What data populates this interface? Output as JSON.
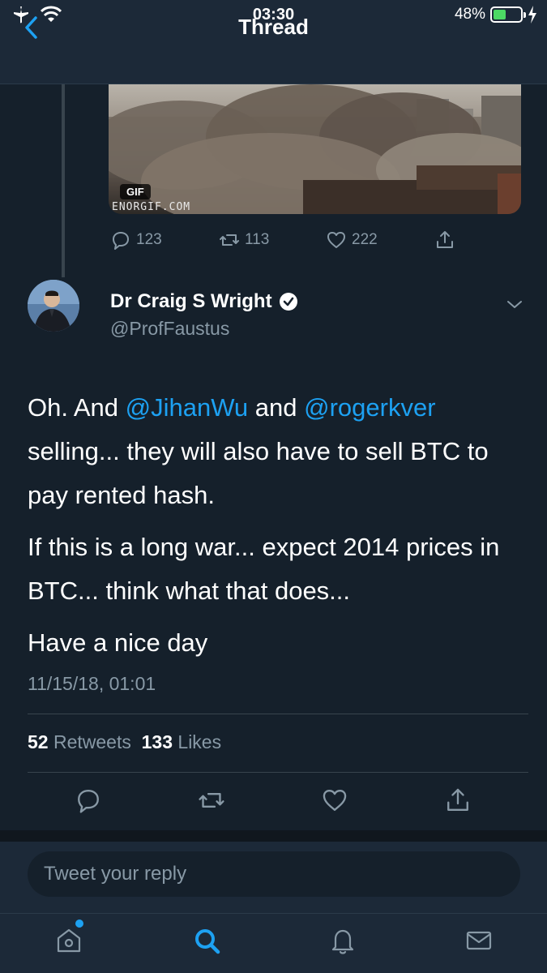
{
  "status": {
    "time": "03:30",
    "battery": "48%",
    "battery_level": 0.48
  },
  "nav": {
    "title": "Thread"
  },
  "prev_tweet": {
    "gif_badge": "GIF",
    "gif_watermark": "ENORGIF.COM",
    "replies": "123",
    "retweets": "113",
    "likes": "222"
  },
  "tweet": {
    "author": "Dr Craig S Wright",
    "handle": "@ProfFaustus",
    "para1_a": "Oh. And ",
    "mention1": "@JihanWu",
    "para1_b": " and ",
    "mention2": "@rogerkver",
    "para1_c": " selling... they will also have to sell BTC to pay rented hash.",
    "para2": "If this is a long war... expect 2014 prices in BTC... think what that does...",
    "para3": "Have a nice day",
    "date": "11/15/18, 01:01",
    "retweet_count": "52",
    "retweet_label": " Retweets",
    "like_count": "133",
    "like_label": " Likes"
  },
  "reply": {
    "placeholder": "Tweet your reply"
  },
  "colors": {
    "accent": "#1da1f2",
    "background": "#15202b",
    "muted": "#8899a6"
  }
}
